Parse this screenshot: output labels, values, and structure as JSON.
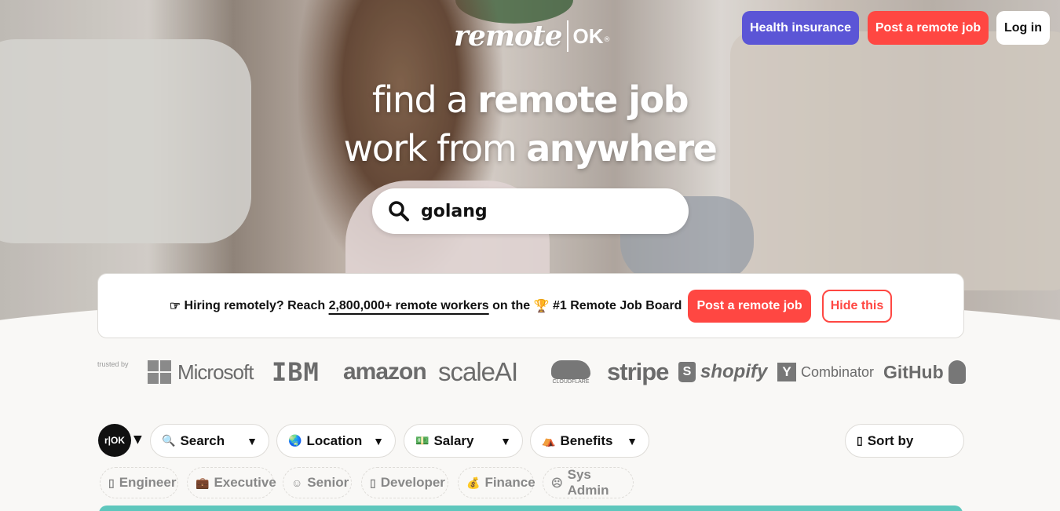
{
  "header": {
    "logo_word": "remote",
    "logo_ok": "OK",
    "logo_reg": "®",
    "nav": {
      "health_insurance": "Health insurance",
      "post_job": "Post a remote job",
      "login": "Log in"
    }
  },
  "hero": {
    "line1_light": "find a ",
    "line1_bold": "remote job",
    "line2_light": "work from ",
    "line2_bold": "anywhere",
    "search_value": "golang"
  },
  "banner": {
    "emoji": "☞",
    "part1": " Hiring remotely? Reach ",
    "highlight": "2,800,000+ remote workers",
    "part2": " on the ",
    "trophy": "🏆",
    "part3": " #1 Remote Job Board",
    "post_button": "Post a remote job",
    "hide_button": "Hide this"
  },
  "trusted": {
    "label": "trusted by",
    "brands": {
      "microsoft": "Microsoft",
      "ibm": "IBM",
      "amazon": "amazon",
      "scaleai": "scaleAI",
      "cloudflare": "CLOUDFLARE",
      "stripe": "stripe",
      "shopify": "shopify",
      "yc_mark": "Y",
      "combinator": "Combinator",
      "github": "GitHub"
    }
  },
  "filters": {
    "rok_label": "r|OK",
    "search": "Search",
    "location": "Location",
    "salary": "Salary",
    "benefits": "Benefits",
    "sort": "Sort by"
  },
  "tags": [
    "Engineer",
    "Executive",
    "Senior",
    "Developer",
    "Finance",
    "Sys Admin"
  ],
  "colors": {
    "health_btn": "#5b55d6",
    "brand_red": "#ff4742",
    "teal": "#5fc7bd"
  }
}
